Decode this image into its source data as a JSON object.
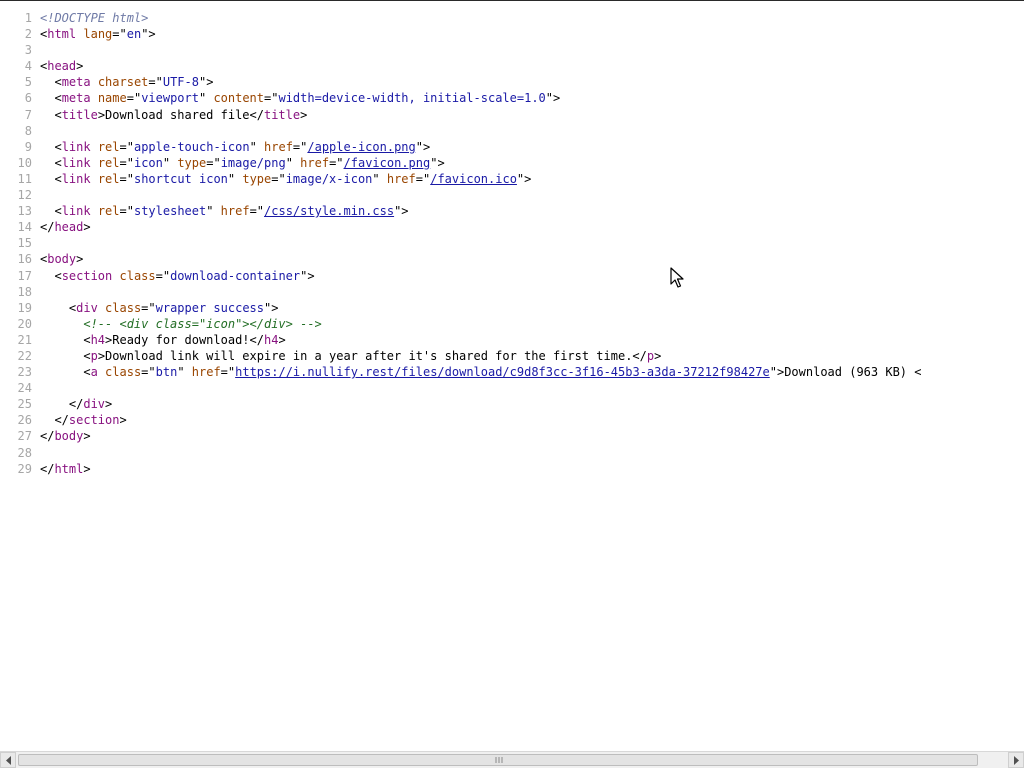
{
  "source_lines": [
    {
      "n": "1",
      "segments": [
        {
          "c": "doc",
          "t": "<!DOCTYPE html>"
        }
      ]
    },
    {
      "n": "2",
      "segments": [
        {
          "c": "p",
          "t": "<"
        },
        {
          "c": "t",
          "t": "html"
        },
        {
          "c": "p",
          "t": " "
        },
        {
          "c": "a",
          "t": "lang"
        },
        {
          "c": "p",
          "t": "=\""
        },
        {
          "c": "v",
          "t": "en"
        },
        {
          "c": "p",
          "t": "\">"
        }
      ]
    },
    {
      "n": "3",
      "segments": []
    },
    {
      "n": "4",
      "segments": [
        {
          "c": "p",
          "t": "<"
        },
        {
          "c": "t",
          "t": "head"
        },
        {
          "c": "p",
          "t": ">"
        }
      ]
    },
    {
      "n": "5",
      "segments": [
        {
          "c": "p",
          "t": "  <"
        },
        {
          "c": "t",
          "t": "meta"
        },
        {
          "c": "p",
          "t": " "
        },
        {
          "c": "a",
          "t": "charset"
        },
        {
          "c": "p",
          "t": "=\""
        },
        {
          "c": "v",
          "t": "UTF-8"
        },
        {
          "c": "p",
          "t": "\">"
        }
      ]
    },
    {
      "n": "6",
      "segments": [
        {
          "c": "p",
          "t": "  <"
        },
        {
          "c": "t",
          "t": "meta"
        },
        {
          "c": "p",
          "t": " "
        },
        {
          "c": "a",
          "t": "name"
        },
        {
          "c": "p",
          "t": "=\""
        },
        {
          "c": "v",
          "t": "viewport"
        },
        {
          "c": "p",
          "t": "\" "
        },
        {
          "c": "a",
          "t": "content"
        },
        {
          "c": "p",
          "t": "=\""
        },
        {
          "c": "v",
          "t": "width=device-width, initial-scale=1.0"
        },
        {
          "c": "p",
          "t": "\">"
        }
      ]
    },
    {
      "n": "7",
      "segments": [
        {
          "c": "p",
          "t": "  <"
        },
        {
          "c": "t",
          "t": "title"
        },
        {
          "c": "p",
          "t": ">Download shared file</"
        },
        {
          "c": "t",
          "t": "title"
        },
        {
          "c": "p",
          "t": ">"
        }
      ]
    },
    {
      "n": "8",
      "segments": []
    },
    {
      "n": "9",
      "segments": [
        {
          "c": "p",
          "t": "  <"
        },
        {
          "c": "t",
          "t": "link"
        },
        {
          "c": "p",
          "t": " "
        },
        {
          "c": "a",
          "t": "rel"
        },
        {
          "c": "p",
          "t": "=\""
        },
        {
          "c": "v",
          "t": "apple-touch-icon"
        },
        {
          "c": "p",
          "t": "\" "
        },
        {
          "c": "a",
          "t": "href"
        },
        {
          "c": "p",
          "t": "=\""
        },
        {
          "c": "lnk",
          "t": "/apple-icon.png"
        },
        {
          "c": "p",
          "t": "\">"
        }
      ]
    },
    {
      "n": "10",
      "segments": [
        {
          "c": "p",
          "t": "  <"
        },
        {
          "c": "t",
          "t": "link"
        },
        {
          "c": "p",
          "t": " "
        },
        {
          "c": "a",
          "t": "rel"
        },
        {
          "c": "p",
          "t": "=\""
        },
        {
          "c": "v",
          "t": "icon"
        },
        {
          "c": "p",
          "t": "\" "
        },
        {
          "c": "a",
          "t": "type"
        },
        {
          "c": "p",
          "t": "=\""
        },
        {
          "c": "v",
          "t": "image/png"
        },
        {
          "c": "p",
          "t": "\" "
        },
        {
          "c": "a",
          "t": "href"
        },
        {
          "c": "p",
          "t": "=\""
        },
        {
          "c": "lnk",
          "t": "/favicon.png"
        },
        {
          "c": "p",
          "t": "\">"
        }
      ]
    },
    {
      "n": "11",
      "segments": [
        {
          "c": "p",
          "t": "  <"
        },
        {
          "c": "t",
          "t": "link"
        },
        {
          "c": "p",
          "t": " "
        },
        {
          "c": "a",
          "t": "rel"
        },
        {
          "c": "p",
          "t": "=\""
        },
        {
          "c": "v",
          "t": "shortcut icon"
        },
        {
          "c": "p",
          "t": "\" "
        },
        {
          "c": "a",
          "t": "type"
        },
        {
          "c": "p",
          "t": "=\""
        },
        {
          "c": "v",
          "t": "image/x-icon"
        },
        {
          "c": "p",
          "t": "\" "
        },
        {
          "c": "a",
          "t": "href"
        },
        {
          "c": "p",
          "t": "=\""
        },
        {
          "c": "lnk",
          "t": "/favicon.ico"
        },
        {
          "c": "p",
          "t": "\">"
        }
      ]
    },
    {
      "n": "12",
      "segments": []
    },
    {
      "n": "13",
      "segments": [
        {
          "c": "p",
          "t": "  <"
        },
        {
          "c": "t",
          "t": "link"
        },
        {
          "c": "p",
          "t": " "
        },
        {
          "c": "a",
          "t": "rel"
        },
        {
          "c": "p",
          "t": "=\""
        },
        {
          "c": "v",
          "t": "stylesheet"
        },
        {
          "c": "p",
          "t": "\" "
        },
        {
          "c": "a",
          "t": "href"
        },
        {
          "c": "p",
          "t": "=\""
        },
        {
          "c": "lnk",
          "t": "/css/style.min.css"
        },
        {
          "c": "p",
          "t": "\">"
        }
      ]
    },
    {
      "n": "14",
      "segments": [
        {
          "c": "p",
          "t": "</"
        },
        {
          "c": "t",
          "t": "head"
        },
        {
          "c": "p",
          "t": ">"
        }
      ]
    },
    {
      "n": "15",
      "segments": []
    },
    {
      "n": "16",
      "segments": [
        {
          "c": "p",
          "t": "<"
        },
        {
          "c": "t",
          "t": "body"
        },
        {
          "c": "p",
          "t": ">"
        }
      ]
    },
    {
      "n": "17",
      "segments": [
        {
          "c": "p",
          "t": "  <"
        },
        {
          "c": "t",
          "t": "section"
        },
        {
          "c": "p",
          "t": " "
        },
        {
          "c": "a",
          "t": "class"
        },
        {
          "c": "p",
          "t": "=\""
        },
        {
          "c": "v",
          "t": "download-container"
        },
        {
          "c": "p",
          "t": "\">"
        }
      ]
    },
    {
      "n": "18",
      "segments": []
    },
    {
      "n": "19",
      "segments": [
        {
          "c": "p",
          "t": "    <"
        },
        {
          "c": "t",
          "t": "div"
        },
        {
          "c": "p",
          "t": " "
        },
        {
          "c": "a",
          "t": "class"
        },
        {
          "c": "p",
          "t": "=\""
        },
        {
          "c": "v",
          "t": "wrapper success"
        },
        {
          "c": "p",
          "t": "\">"
        }
      ]
    },
    {
      "n": "20",
      "segments": [
        {
          "c": "p",
          "t": "      "
        },
        {
          "c": "cmt",
          "t": "<!-- <div class=\"icon\"></div> -->"
        }
      ]
    },
    {
      "n": "21",
      "segments": [
        {
          "c": "p",
          "t": "      <"
        },
        {
          "c": "t",
          "t": "h4"
        },
        {
          "c": "p",
          "t": ">Ready for download!</"
        },
        {
          "c": "t",
          "t": "h4"
        },
        {
          "c": "p",
          "t": ">"
        }
      ]
    },
    {
      "n": "22",
      "segments": [
        {
          "c": "p",
          "t": "      <"
        },
        {
          "c": "t",
          "t": "p"
        },
        {
          "c": "p",
          "t": ">Download link will expire in a year after it's shared for the first time.</"
        },
        {
          "c": "t",
          "t": "p"
        },
        {
          "c": "p",
          "t": ">"
        }
      ]
    },
    {
      "n": "23",
      "segments": [
        {
          "c": "p",
          "t": "      <"
        },
        {
          "c": "t",
          "t": "a"
        },
        {
          "c": "p",
          "t": " "
        },
        {
          "c": "a",
          "t": "class"
        },
        {
          "c": "p",
          "t": "=\""
        },
        {
          "c": "v",
          "t": "btn"
        },
        {
          "c": "p",
          "t": "\" "
        },
        {
          "c": "a",
          "t": "href"
        },
        {
          "c": "p",
          "t": "=\""
        },
        {
          "c": "lnk",
          "t": "https://i.nullify.rest/files/download/c9d8f3cc-3f16-45b3-a3da-37212f98427e"
        },
        {
          "c": "p",
          "t": "\">Download (963 KB) <"
        }
      ]
    },
    {
      "n": "24",
      "segments": []
    },
    {
      "n": "25",
      "segments": [
        {
          "c": "p",
          "t": "    </"
        },
        {
          "c": "t",
          "t": "div"
        },
        {
          "c": "p",
          "t": ">"
        }
      ]
    },
    {
      "n": "26",
      "segments": [
        {
          "c": "p",
          "t": "  </"
        },
        {
          "c": "t",
          "t": "section"
        },
        {
          "c": "p",
          "t": ">"
        }
      ]
    },
    {
      "n": "27",
      "segments": [
        {
          "c": "p",
          "t": "</"
        },
        {
          "c": "t",
          "t": "body"
        },
        {
          "c": "p",
          "t": ">"
        }
      ]
    },
    {
      "n": "28",
      "segments": []
    },
    {
      "n": "29",
      "segments": [
        {
          "c": "p",
          "t": "</"
        },
        {
          "c": "t",
          "t": "html"
        },
        {
          "c": "p",
          "t": ">"
        }
      ]
    }
  ],
  "icons": {
    "cursor": "mouse-pointer-icon",
    "scroll_left": "scroll-left-arrow-icon",
    "scroll_right": "scroll-right-arrow-icon"
  },
  "colors": {
    "tag": "#881280",
    "attribute": "#994500",
    "value": "#1a1aa6",
    "comment": "#236e25",
    "doctype": "#6f7aa6",
    "line_number": "#a6a6a6"
  }
}
